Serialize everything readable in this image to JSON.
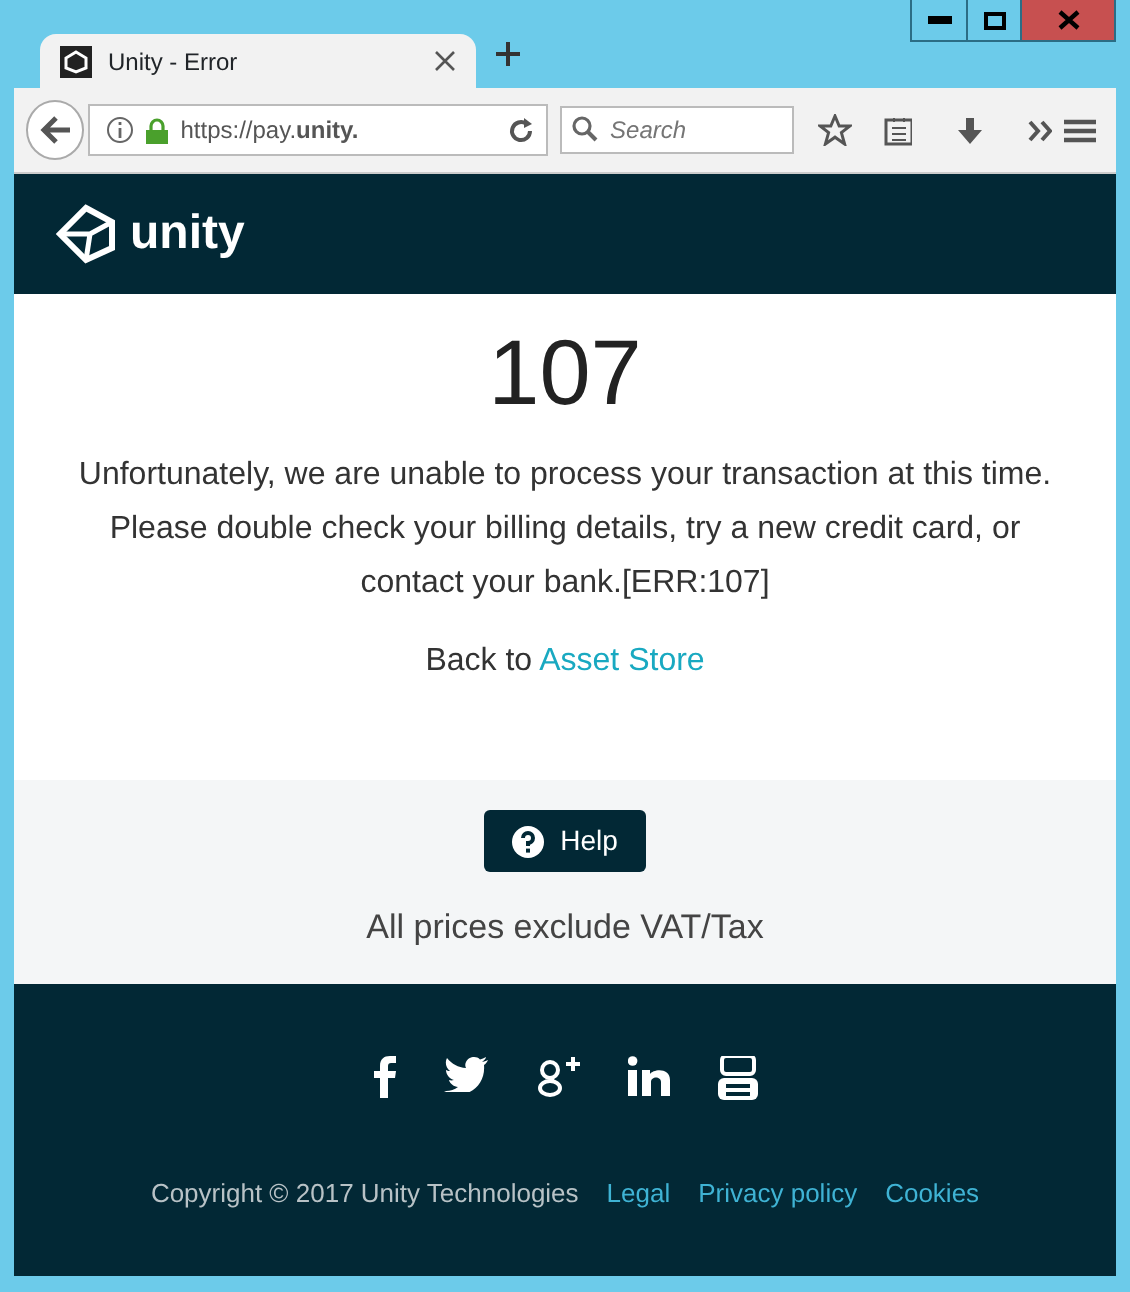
{
  "browser": {
    "tab_title": "Unity - Error",
    "url": "https://pay.**unity.**",
    "search_placeholder": "Search"
  },
  "header": {
    "logo_text": "unity"
  },
  "error": {
    "code": "107",
    "message": "Unfortunately, we are unable to process your transaction at this time. Please double check your billing details, try a new credit card, or contact your bank.[ERR:107]",
    "back_text": "Back to",
    "back_link": "Asset Store"
  },
  "help": {
    "button": "Help",
    "note": "All prices exclude VAT/Tax"
  },
  "footer": {
    "copyright": "Copyright © 2017 Unity Technologies",
    "links": [
      "Legal",
      "Privacy policy",
      "Cookies"
    ]
  }
}
